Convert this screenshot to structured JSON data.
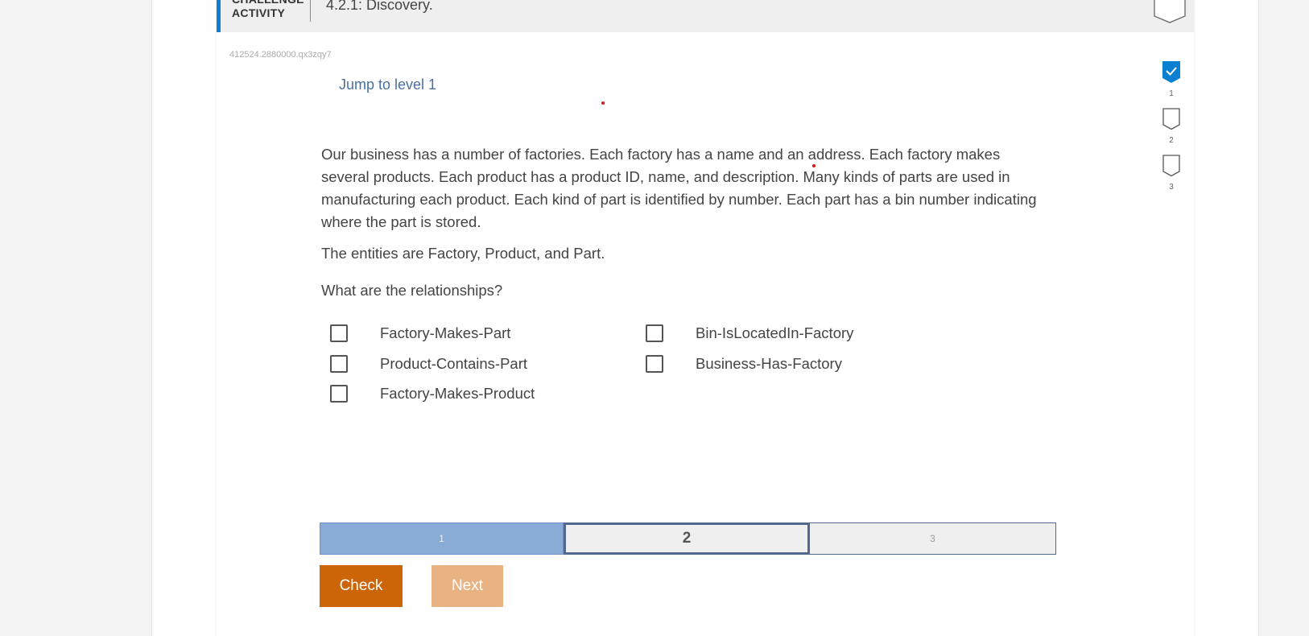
{
  "header": {
    "type_line1": "CHALLENGE",
    "type_line2": "ACTIVITY",
    "title": "4.2.1: Discovery."
  },
  "activity_id": "412524.2880000.qx3zqy7",
  "jump_link": "Jump to level 1",
  "prompt": "Our business has a number of factories. Each factory has a name and an address. Each factory makes several products. Each product has a product ID, name, and description. Many kinds of parts are used in manufacturing each product. Each kind of part is identified by number. Each part has a bin number indicating where the part is stored.",
  "entities_text": "The entities are Factory, Product, and Part.",
  "question": "What are the relationships?",
  "options": [
    {
      "label": "Factory-Makes-Part",
      "checked": false
    },
    {
      "label": "Product-Contains-Part",
      "checked": false
    },
    {
      "label": "Factory-Makes-Product",
      "checked": false
    },
    {
      "label": "Bin-IsLocatedIn-Factory",
      "checked": false
    },
    {
      "label": "Business-Has-Factory",
      "checked": false
    }
  ],
  "levels": [
    {
      "number": "1",
      "status": "completed"
    },
    {
      "number": "2",
      "status": "incomplete"
    },
    {
      "number": "3",
      "status": "incomplete"
    }
  ],
  "progress": {
    "segments": [
      "1",
      "2",
      "3"
    ],
    "current": "2"
  },
  "buttons": {
    "check": "Check",
    "next": "Next"
  },
  "colors": {
    "accent_blue": "#0b7fd0",
    "check_button": "#cc6508",
    "next_button_disabled": "#e9b282",
    "progress_done": "#88acd6",
    "progress_border": "#51698f",
    "link": "#4a6f9e"
  }
}
